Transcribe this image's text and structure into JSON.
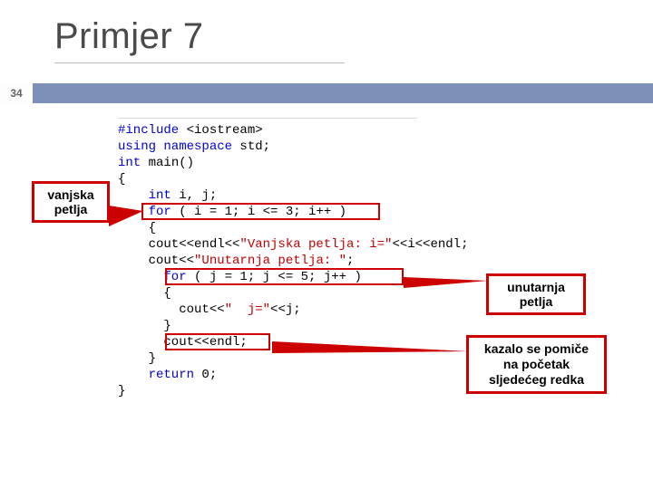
{
  "title": "Primjer 7",
  "page_number": "34",
  "code": {
    "l1a": "#include ",
    "l1b": "<iostream>",
    "l2a": "using namespace ",
    "l2b": "std;",
    "l3a": "int ",
    "l3b": "main()",
    "l4": "{",
    "l5a": "    int ",
    "l5b": "i, j;",
    "l6a": "    for ",
    "l6b": "( i = 1; i <= 3; i++ )",
    "l7": "    {",
    "l8a": "    cout<<endl<<",
    "l8b": "\"Vanjska petlja: i=\"",
    "l8c": "<<i<<endl;",
    "l9a": "    cout<<",
    "l9b": "\"Unutarnja petlja: \"",
    "l9c": ";",
    "l10a": "      for ",
    "l10b": "( j = 1; j <= 5; j++ )",
    "l11": "      {",
    "l12a": "        cout<<",
    "l12b": "\"  j=\"",
    "l12c": "<<j;",
    "l13": "      }",
    "l14": "      cout<<endl;",
    "l15": "    }",
    "l16a": "    return ",
    "l16b": "0;",
    "l17": "}"
  },
  "callouts": {
    "left": "vanjska petlja",
    "right_top": "unutarnja petlja",
    "right_bottom": "kazalo se pomiče na početak sljedećeg redka"
  }
}
